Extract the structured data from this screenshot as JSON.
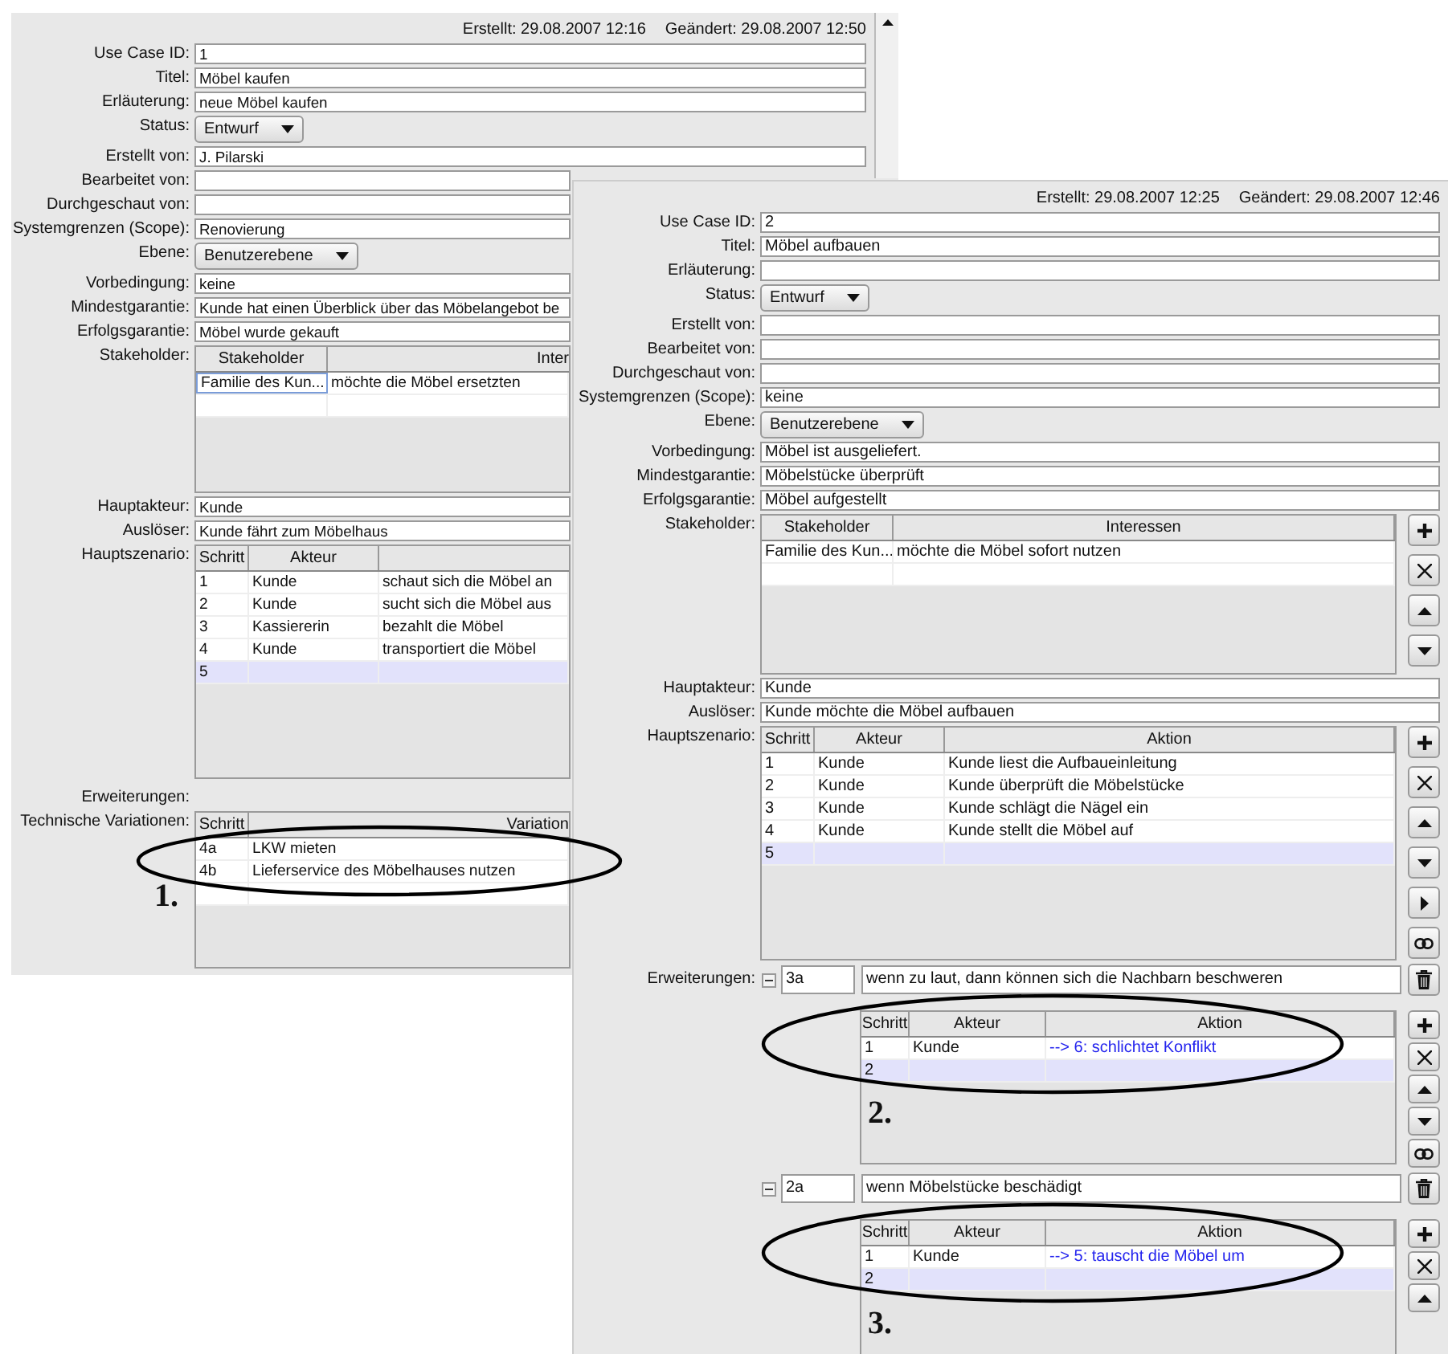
{
  "windows": [
    {
      "created": "Erstellt: 29.08.2007 12:16",
      "changed": "Geändert: 29.08.2007 12:50",
      "fields": [
        {
          "kind": "text",
          "label": "Use Case ID:",
          "value": "1"
        },
        {
          "kind": "text",
          "label": "Titel:",
          "value": "Möbel kaufen"
        },
        {
          "kind": "text",
          "label": "Erläuterung:",
          "value": "neue Möbel kaufen"
        },
        {
          "kind": "combo",
          "label": "Status:",
          "value": "Entwurf"
        },
        {
          "kind": "text",
          "label": "Erstellt von:",
          "value": "J. Pilarski"
        },
        {
          "kind": "text",
          "label": "Bearbeitet von:"
        },
        {
          "kind": "text",
          "label": "Durchgeschaut von:"
        },
        {
          "kind": "text",
          "label": "Systemgrenzen (Scope):",
          "value": "Renovierung"
        },
        {
          "kind": "combo",
          "label": "Ebene:",
          "value": "Benutzerebene"
        },
        {
          "kind": "text",
          "label": "Vorbedingung:",
          "value": "keine"
        },
        {
          "kind": "text",
          "label": "Mindestgarantie:",
          "value": "Kunde hat einen Überblick über das Möbelangebot be"
        },
        {
          "kind": "text",
          "label": "Erfolgsgarantie:",
          "value": "Möbel  wurde gekauft"
        }
      ],
      "stakeholder": {
        "label": "Stakeholder:",
        "columns": [
          "Stakeholder",
          "Inter"
        ],
        "rows": [
          {
            "cells": [
              "Familie des Kun...",
              "möchte die Möbel ersetzten"
            ],
            "focused": true,
            "selected": false
          }
        ]
      },
      "fields_after": [
        {
          "kind": "text",
          "label": "Hauptakteur:",
          "value": "Kunde"
        },
        {
          "kind": "text",
          "label": "Auslöser:",
          "value": "Kunde fährt zum Möbelhaus"
        }
      ],
      "scenario": {
        "label": "Hauptszenario:",
        "columns": [
          "Schritt",
          "Akteur"
        ],
        "rows": [
          {
            "cells": [
              "1",
              "Kunde",
              "schaut sich die Möbel an"
            ],
            "selected": false
          },
          {
            "cells": [
              "2",
              "Kunde",
              "sucht sich die Möbel aus"
            ],
            "selected": false
          },
          {
            "cells": [
              "3",
              "Kassiererin",
              "bezahlt die Möbel"
            ],
            "selected": false
          },
          {
            "cells": [
              "4",
              "Kunde",
              "transportiert die Möbel"
            ],
            "selected": false
          },
          {
            "cells": [
              "5"
            ],
            "selected": true
          }
        ]
      },
      "extensions": {
        "label": "Erweiterungen:"
      },
      "variations": {
        "label": "Technische Variationen:",
        "columns": [
          "Schritt",
          "Variation"
        ],
        "rows": [
          {
            "cells": [
              "4a",
              "LKW mieten"
            ],
            "selected": false
          },
          {
            "cells": [
              "4b",
              "Lieferservice des Möbelhauses nutzen"
            ],
            "selected": false
          }
        ]
      }
    },
    {
      "created": "Erstellt: 29.08.2007 12:25",
      "changed": "Geändert: 29.08.2007 12:46",
      "fields": [
        {
          "kind": "text",
          "label": "Use Case ID:",
          "value": "2"
        },
        {
          "kind": "text",
          "label": "Titel:",
          "value": "Möbel aufbauen"
        },
        {
          "kind": "text",
          "label": "Erläuterung:"
        },
        {
          "kind": "combo",
          "label": "Status:",
          "value": "Entwurf"
        },
        {
          "kind": "text",
          "label": "Erstellt von:"
        },
        {
          "kind": "text",
          "label": "Bearbeitet von:"
        },
        {
          "kind": "text",
          "label": "Durchgeschaut von:"
        },
        {
          "kind": "text",
          "label": "Systemgrenzen (Scope):",
          "value": "keine"
        },
        {
          "kind": "combo",
          "label": "Ebene:",
          "value": "Benutzerebene"
        },
        {
          "kind": "text",
          "label": "Vorbedingung:",
          "value": "Möbel ist ausgeliefert."
        },
        {
          "kind": "text",
          "label": "Mindestgarantie:",
          "value": "Möbelstücke überprüft"
        },
        {
          "kind": "text",
          "label": "Erfolgsgarantie:",
          "value": "Möbel aufgestellt"
        }
      ],
      "stakeholder": {
        "label": "Stakeholder:",
        "columns": [
          "Stakeholder",
          "Interessen"
        ],
        "tools": [
          {
            "kind": "add"
          },
          {
            "kind": "remove"
          },
          {
            "kind": "up"
          },
          {
            "kind": "down"
          }
        ],
        "rows": [
          {
            "cells": [
              "Familie des Kun...",
              "möchte die Möbel sofort nutzen"
            ],
            "focused": false,
            "selected": false
          }
        ]
      },
      "fields_after": [
        {
          "kind": "text",
          "label": "Hauptakteur:",
          "value": "Kunde"
        },
        {
          "kind": "text",
          "label": "Auslöser:",
          "value": "Kunde möchte die Möbel aufbauen"
        }
      ],
      "scenario": {
        "label": "Hauptszenario:",
        "columns": [
          "Schritt",
          "Akteur",
          "Aktion"
        ],
        "tools": [
          {
            "kind": "add"
          },
          {
            "kind": "remove"
          },
          {
            "kind": "up"
          },
          {
            "kind": "down"
          },
          {
            "kind": "right"
          },
          {
            "kind": "link"
          }
        ],
        "rows": [
          {
            "cells": [
              "1",
              "Kunde",
              "Kunde liest die Aufbaueinleitung"
            ],
            "selected": false
          },
          {
            "cells": [
              "2",
              "Kunde",
              "Kunde überprüft die Möbelstücke"
            ],
            "selected": false
          },
          {
            "cells": [
              "3",
              "Kunde",
              "Kunde schlägt die Nägel ein"
            ],
            "selected": false
          },
          {
            "cells": [
              "4",
              "Kunde",
              "Kunde stellt die Möbel auf"
            ],
            "selected": false
          },
          {
            "cells": [
              "5"
            ],
            "selected": true
          }
        ]
      },
      "extensions": {
        "label": "Erweiterungen:",
        "items": [
          {
            "expanded": true,
            "step": "3a",
            "condition": "wenn zu  laut, dann können sich die Nachbarn beschweren",
            "table": {
              "columns": [
                "Schritt",
                "Akteur",
                "Aktion"
              ],
              "tools": [
                {
                  "kind": "add"
                },
                {
                  "kind": "remove"
                },
                {
                  "kind": "up"
                },
                {
                  "kind": "down"
                },
                {
                  "kind": "link"
                }
              ],
              "rows": [
                {
                  "cells": [
                    "1",
                    "Kunde",
                    "--> 6: schlichtet Konflikt"
                  ],
                  "reference": true,
                  "selected": false
                },
                {
                  "cells": [
                    "2"
                  ],
                  "reference": false,
                  "selected": true
                }
              ]
            }
          },
          {
            "expanded": true,
            "step": "2a",
            "condition": "wenn Möbelstücke beschädigt",
            "table": {
              "columns": [
                "Schritt",
                "Akteur",
                "Aktion"
              ],
              "tools": [
                {
                  "kind": "add"
                },
                {
                  "kind": "remove"
                },
                {
                  "kind": "up"
                }
              ],
              "rows": [
                {
                  "cells": [
                    "1",
                    "Kunde",
                    "--> 5: tauscht die Möbel um"
                  ],
                  "reference": true,
                  "selected": false
                },
                {
                  "cells": [
                    "2"
                  ],
                  "reference": false,
                  "selected": true
                }
              ]
            }
          }
        ]
      }
    }
  ],
  "annotations": [
    {
      "label": "1."
    },
    {
      "label": "2."
    },
    {
      "label": "3."
    }
  ]
}
